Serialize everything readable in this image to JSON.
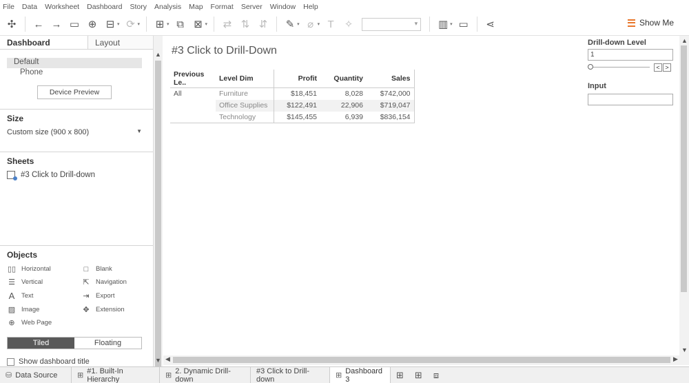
{
  "menu": [
    "File",
    "Data",
    "Worksheet",
    "Dashboard",
    "Story",
    "Analysis",
    "Map",
    "Format",
    "Server",
    "Window",
    "Help"
  ],
  "toolbar": {
    "show_me": "Show Me"
  },
  "left_panel": {
    "tabs": [
      "Dashboard",
      "Layout"
    ],
    "devices": [
      "Default",
      "Phone"
    ],
    "device_preview_label": "Device Preview",
    "size_title": "Size",
    "size_value": "Custom size (900 x 800)",
    "sheets_title": "Sheets",
    "sheets": [
      "#3 Click to Drill-down"
    ],
    "objects_title": "Objects",
    "objects": [
      {
        "label": "Horizontal",
        "icon": "horizontal-container-icon"
      },
      {
        "label": "Blank",
        "icon": "blank-icon"
      },
      {
        "label": "Vertical",
        "icon": "vertical-container-icon"
      },
      {
        "label": "Navigation",
        "icon": "navigation-icon"
      },
      {
        "label": "Text",
        "icon": "text-icon"
      },
      {
        "label": "Export",
        "icon": "export-icon"
      },
      {
        "label": "Image",
        "icon": "image-icon"
      },
      {
        "label": "Extension",
        "icon": "extension-icon"
      },
      {
        "label": "Web Page",
        "icon": "web-page-icon"
      }
    ],
    "layout_toggle": [
      "Tiled",
      "Floating"
    ],
    "show_title_label": "Show dashboard title"
  },
  "dashboard": {
    "title": "#3 Click to Drill-Down",
    "table": {
      "headers": [
        "Previous Le..",
        "Level Dim",
        "Profit",
        "Quantity",
        "Sales"
      ],
      "rows": [
        [
          "All",
          "Furniture",
          "$18,451",
          "8,028",
          "$742,000"
        ],
        [
          "",
          "Office Supplies",
          "$122,491",
          "22,906",
          "$719,047"
        ],
        [
          "",
          "Technology",
          "$145,455",
          "6,939",
          "$836,154"
        ]
      ]
    },
    "drilldown": {
      "label": "Drill-down Level",
      "value": "1",
      "slider_fraction": 0
    },
    "input": {
      "label": "Input",
      "value": ""
    }
  },
  "bottom_tabs": [
    {
      "label": "Data Source",
      "icon": "data-source-icon"
    },
    {
      "label": "#1. Built-In Hierarchy",
      "icon": "worksheet-icon"
    },
    {
      "label": "2. Dynamic Drill-down",
      "icon": "worksheet-icon"
    },
    {
      "label": "#3 Click to Drill-down",
      "icon": ""
    },
    {
      "label": "Dashboard 3",
      "icon": "dashboard-icon",
      "active": true
    }
  ]
}
